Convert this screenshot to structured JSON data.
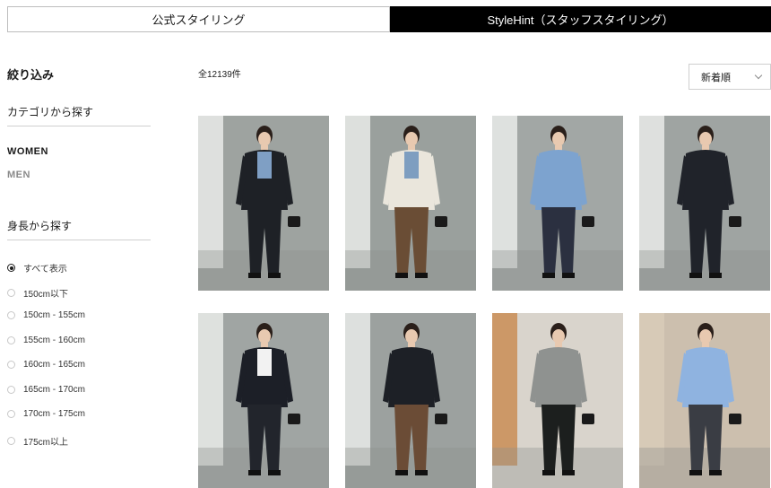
{
  "tabs": {
    "official": "公式スタイリング",
    "stylehint": "StyleHint（スタッフスタイリング）"
  },
  "sidebar": {
    "filter_title": "絞り込み",
    "category_heading": "カテゴリから探す",
    "women": "WOMEN",
    "men": "MEN",
    "height_heading": "身長から探す",
    "height_options": [
      {
        "label": "すべて表示",
        "selected": true
      },
      {
        "label": "150cm以下",
        "selected": false
      },
      {
        "label": "150cm - 155cm",
        "selected": false
      },
      {
        "label": "155cm - 160cm",
        "selected": false
      },
      {
        "label": "160cm - 165cm",
        "selected": false
      },
      {
        "label": "165cm - 170cm",
        "selected": false
      },
      {
        "label": "170cm - 175cm",
        "selected": false
      },
      {
        "label": "175cm以上",
        "selected": false
      }
    ]
  },
  "results": {
    "count": "全12139件",
    "sort_value": "新着順"
  },
  "photos": [
    {
      "bg": "#9ea3a0",
      "top": "#1e2126",
      "inner": "#7f9fc4",
      "bottom": "#1e2126",
      "wall": "#e9ebe9"
    },
    {
      "bg": "#9aa09d",
      "top": "#eae6dc",
      "inner": "#7e9ec0",
      "bottom": "#6a4d35",
      "wall": "#e9ebe9"
    },
    {
      "bg": "#a2a7a5",
      "top": "#7da3cf",
      "inner": "#7da3cf",
      "bottom": "#2b3040",
      "wall": "#e9ebe9"
    },
    {
      "bg": "#9fa4a2",
      "top": "#20232a",
      "inner": "#20232a",
      "bottom": "#20232a",
      "wall": "#e9ebe9"
    },
    {
      "bg": "#a0a5a3",
      "top": "#1c1f27",
      "inner": "#f2f2f2",
      "bottom": "#22252c",
      "wall": "#e9ebe9"
    },
    {
      "bg": "#9ca19f",
      "top": "#1d2026",
      "inner": "#1d2026",
      "bottom": "#6b4c36",
      "wall": "#e9ebe9"
    },
    {
      "bg": "#d9d4cc",
      "top": "#8f9290",
      "inner": "#8f9290",
      "bottom": "#1c1f1e",
      "wall": "#c98d55"
    },
    {
      "bg": "#ccbfae",
      "top": "#8fb3e0",
      "inner": "#8fb3e0",
      "bottom": "#3a3d44",
      "wall": "#d8cbb8"
    }
  ]
}
